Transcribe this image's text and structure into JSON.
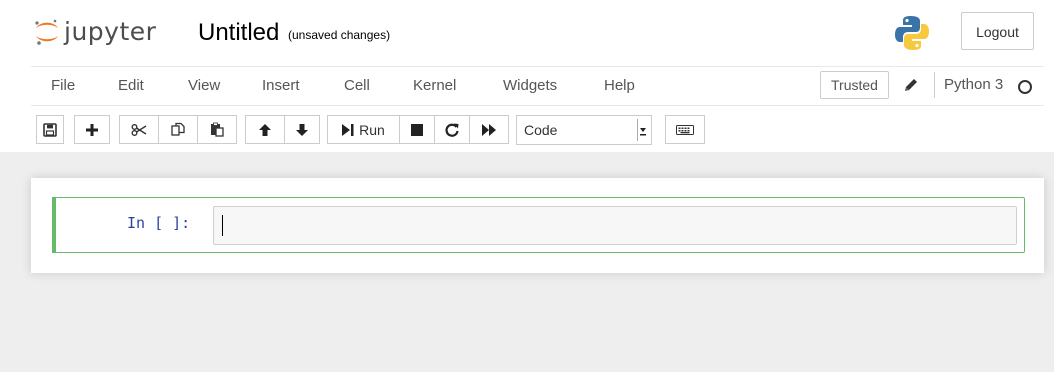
{
  "header": {
    "logo_text": "jupyter",
    "notebook_name": "Untitled",
    "save_status": "(unsaved changes)",
    "logout_label": "Logout"
  },
  "menubar": {
    "items": [
      "File",
      "Edit",
      "View",
      "Insert",
      "Cell",
      "Kernel",
      "Widgets",
      "Help"
    ],
    "trusted_label": "Trusted",
    "kernel_name": "Python 3"
  },
  "toolbar": {
    "run_label": "Run",
    "cell_type": "Code",
    "buttons": [
      "save-icon",
      "plus-icon",
      "cut-icon",
      "copy-icon",
      "paste-icon",
      "arrow-up-icon",
      "arrow-down-icon",
      "run-icon",
      "stop-icon",
      "restart-icon",
      "fast-forward-icon",
      "keyboard-icon"
    ]
  },
  "cell": {
    "prompt": "In [ ]:",
    "source": ""
  },
  "colors": {
    "cell_selected_border": "#66bb6a",
    "cell_left_bar": "#42a5f5",
    "prompt_blue": "#303f9f",
    "jupyter_orange": "#f37726"
  }
}
